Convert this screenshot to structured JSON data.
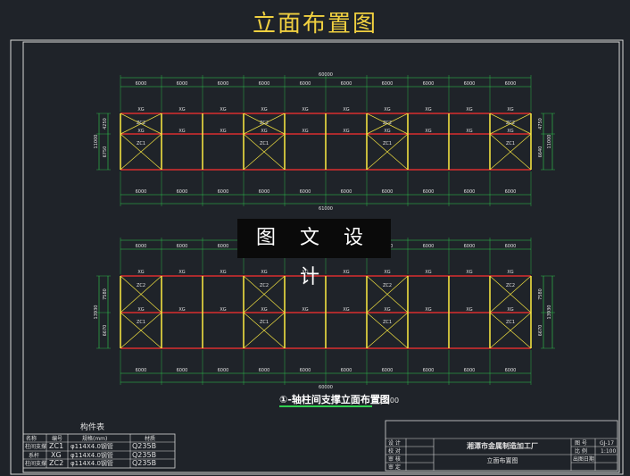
{
  "title": "立面布置图",
  "watermark": "图 文 设 计",
  "colors": {
    "background": "#1f2329",
    "frame": "#d8d8d8",
    "column": "#f0e040",
    "beam": "#ff3030",
    "dim": "#30d050",
    "text": "#e0e0e0",
    "title": "#f0d040"
  },
  "elevation_a": {
    "top_dims": [
      "6000",
      "6000",
      "6000",
      "6000",
      "6000",
      "6000",
      "6000",
      "6000",
      "6000",
      "6000"
    ],
    "top_total": "60000",
    "bottom_dims": [
      "6000",
      "6000",
      "6000",
      "6000",
      "6000",
      "6000",
      "6000",
      "6000",
      "6000",
      "6000"
    ],
    "bottom_total": "61000",
    "left_dims": [
      "4250",
      "6750"
    ],
    "left_total": "11000",
    "right_dims": [
      "4750",
      "6640"
    ],
    "right_total": "11000",
    "upper_labels": [
      "XG",
      "XG",
      "XG",
      "XG",
      "XG",
      "XG",
      "XG",
      "XG",
      "XG",
      "XG"
    ],
    "mid_labels": [
      "XG",
      "XG",
      "XG",
      "XG",
      "XG",
      "XG",
      "XG",
      "XG",
      "XG",
      "XG"
    ],
    "zc2_label": "ZC2",
    "zc1_label": "ZC1"
  },
  "elevation_b": {
    "top_dims": [
      "6000",
      "6000",
      "6000",
      "6000",
      "6000",
      "6000",
      "6000",
      "6000",
      "6000",
      "6000"
    ],
    "top_total": "60000",
    "bottom_dims": [
      "6000",
      "6000",
      "6000",
      "6000",
      "6000",
      "6000",
      "6000",
      "6000",
      "6000",
      "6000"
    ],
    "bottom_total": "60000",
    "left_dims": [
      "7580",
      "6670"
    ],
    "left_total": "13930",
    "right_dims": [
      "7580",
      "6670"
    ],
    "right_total": "13930",
    "upper_labels": [
      "XG",
      "XG",
      "XG",
      "XG",
      "XG",
      "XG",
      "XG",
      "XG",
      "XG",
      "XG"
    ],
    "mid_labels": [
      "XG",
      "XG",
      "XG",
      "XG",
      "XG",
      "XG",
      "XG",
      "XG",
      "XG",
      "XG"
    ],
    "zc2_label": "ZC2",
    "zc1_label": "ZC1"
  },
  "caption": {
    "text": "①-轴柱间支撑立面布置图",
    "scale": "1:100"
  },
  "member_table": {
    "title": "构件表",
    "headers": [
      "名称",
      "编号",
      "规格(mm)",
      "材质"
    ],
    "rows": [
      [
        "柱间支撑",
        "ZC1",
        "φ114X4.0钢管",
        "Q235B"
      ],
      [
        "系杆",
        "XG",
        "φ114X4.0钢管",
        "Q235B"
      ],
      [
        "柱间支撑",
        "ZC2",
        "φ114X4.0钢管",
        "Q235B"
      ]
    ]
  },
  "title_block": {
    "left_labels": [
      "设 计",
      "校 对",
      "审 核",
      "审 定"
    ],
    "company": "湘潭市金属制造加工厂",
    "drawing_name": "立面布置图",
    "right_labels": [
      "图 号",
      "比 例",
      "出图日期"
    ],
    "right_values": [
      "GJ-17",
      "1:100",
      ""
    ]
  }
}
